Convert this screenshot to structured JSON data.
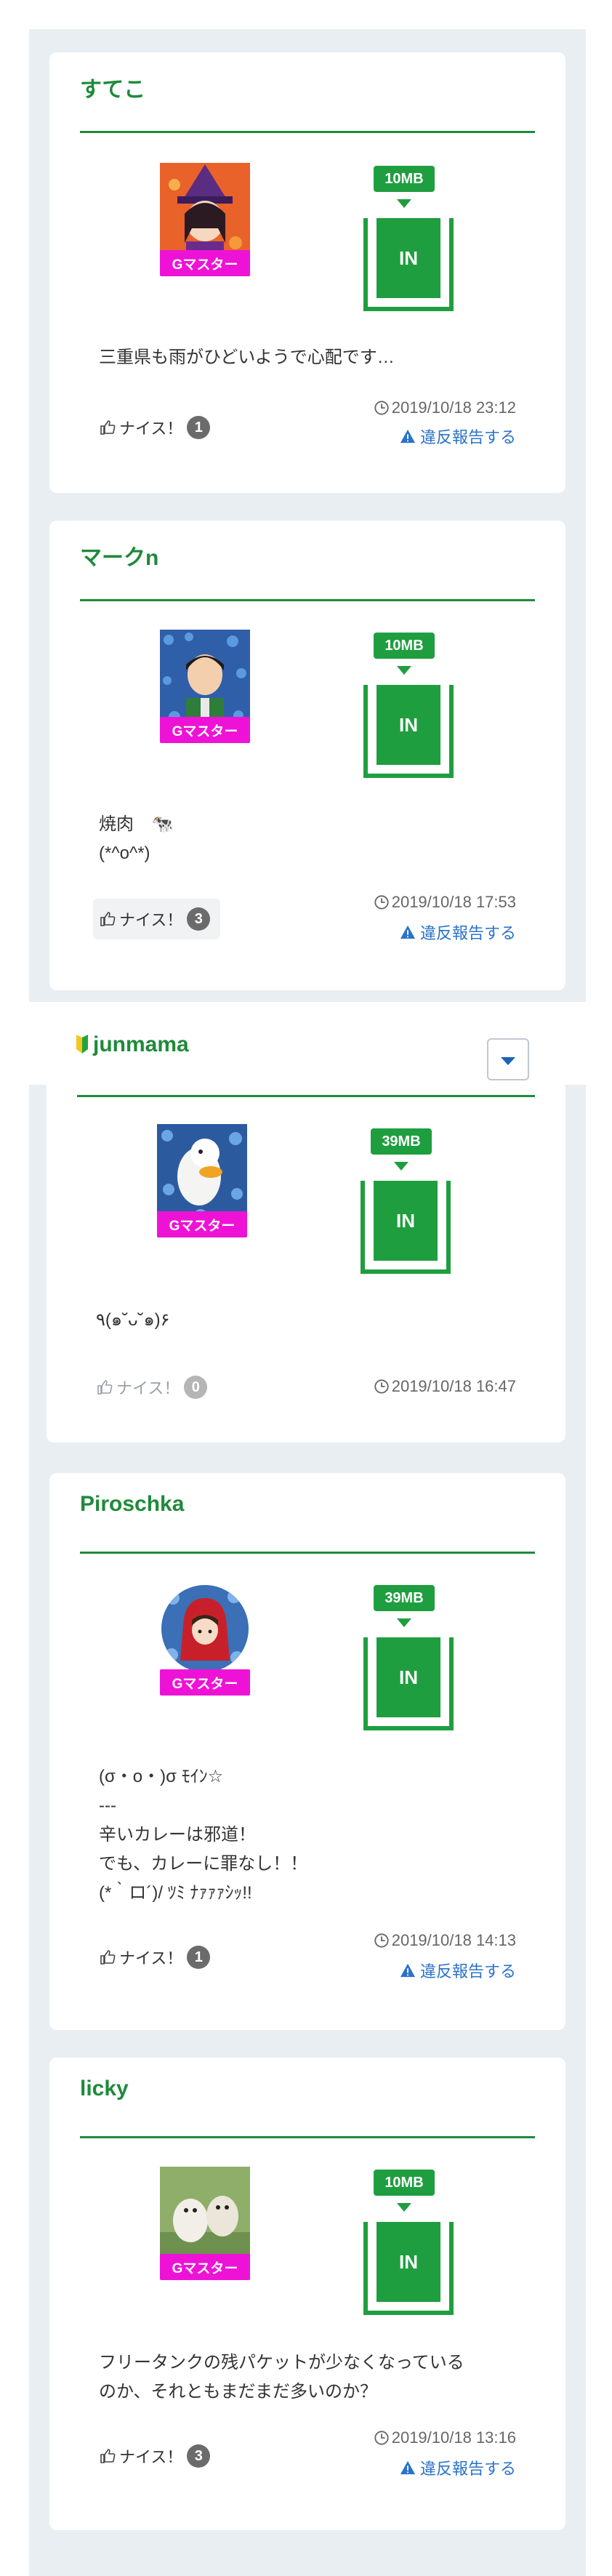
{
  "posts": [
    {
      "author": "すてこ",
      "badge": "Gマスター",
      "usage": "10MB",
      "in_label": "IN",
      "comment": "三重県も雨がひどいようで心配です…",
      "nice_label": "ナイス！",
      "nice_count": "1",
      "timestamp": "2019/10/18 23:12",
      "report": "違反報告する",
      "avatar": "witch-girl"
    },
    {
      "author": "マークn",
      "badge": "Gマスター",
      "usage": "10MB",
      "in_label": "IN",
      "comment": "焼肉　🐄\n(*^o^*)",
      "nice_label": "ナイス！",
      "nice_count": "3",
      "timestamp": "2019/10/18 17:53",
      "report": "違反報告する",
      "avatar": "boy-flowers"
    },
    {
      "author": "junmama",
      "badge": "Gマスター",
      "usage": "39MB",
      "in_label": "IN",
      "comment": "٩(๑˘ᴗ˘๑)۶",
      "nice_label": "ナイス！",
      "nice_count": "0",
      "timestamp": "2019/10/18 16:47",
      "report": "",
      "avatar": "duck-flowers",
      "beginner_icon": "beginner-mark-icon"
    },
    {
      "author": "Piroschka",
      "badge": "Gマスター",
      "usage": "39MB",
      "in_label": "IN",
      "comment": "(σ・o・)σ ﾓｲﾝ☆\n---\n辛いカレーは邪道！\nでも、カレーに罪なし！！\n(*｀ロ´)/ ﾂﾐ ﾅｧｧｧｼｯ!!",
      "nice_label": "ナイス！",
      "nice_count": "1",
      "timestamp": "2019/10/18 14:13",
      "report": "違反報告する",
      "avatar": "red-hood-round"
    },
    {
      "author": "licky",
      "badge": "Gマスター",
      "usage": "10MB",
      "in_label": "IN",
      "comment": "フリータンクの残パケットが少なくなっている\nのか、それともまだまだ多いのか？",
      "nice_label": "ナイス！",
      "nice_count": "3",
      "timestamp": "2019/10/18 13:16",
      "report": "違反報告する",
      "avatar": "puppies"
    }
  ],
  "colors": {
    "brand_green": "#1f8a3b",
    "badge_magenta": "#ee12d6",
    "link_blue": "#2b73c9"
  }
}
